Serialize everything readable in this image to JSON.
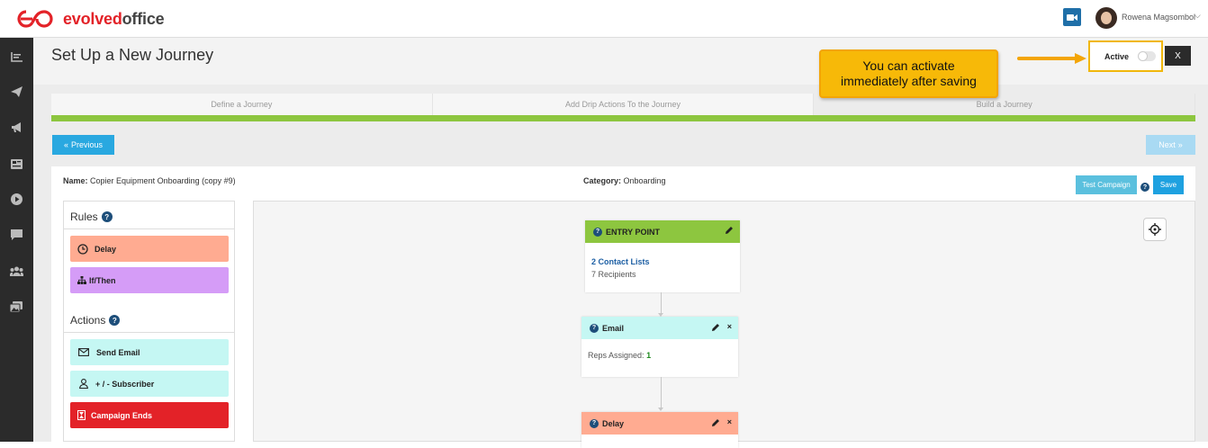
{
  "app": {
    "logo_brand_red": "evolved",
    "logo_brand_gray": "office",
    "user_name": "Rowena Magsombol",
    "colors": {
      "brand_red": "#e32228",
      "primary_blue": "#29a8e0",
      "sidebar": "#2b2b2b",
      "progress_green": "#8dc63f",
      "tooltip_yellow": "#f7b908"
    }
  },
  "header": {
    "title": "Set Up a New Journey",
    "active_label": "Active",
    "active_state": false,
    "close_label": "X"
  },
  "tooltip": {
    "line1": "You can activate",
    "line2": "immediately after saving"
  },
  "steps": [
    {
      "label": "Define a Journey"
    },
    {
      "label": "Add Drip Actions To the Journey"
    },
    {
      "label": "Build a Journey"
    }
  ],
  "nav": {
    "previous_label": "Previous",
    "next_label": "Next"
  },
  "campaign": {
    "name_label": "Name:",
    "name_value": "Copier Equipment Onboarding (copy #9)",
    "category_label": "Category:",
    "category_value": "Onboarding",
    "test_label": "Test Campaign",
    "save_label": "Save"
  },
  "rules": {
    "heading": "Rules",
    "items": [
      {
        "label": "Delay",
        "icon": "clock-icon",
        "color": "#ffab91"
      },
      {
        "label": "If/Then",
        "icon": "sitemap-icon",
        "color": "#d59cf7"
      }
    ]
  },
  "actions": {
    "heading": "Actions",
    "items": [
      {
        "label": "Send Email",
        "icon": "envelope-icon",
        "color": "#c5f7f3"
      },
      {
        "label": "+ / - Subscriber",
        "icon": "user-icon",
        "color": "#c5f7f3"
      },
      {
        "label": "Campaign Ends",
        "icon": "hourglass-icon",
        "color": "#e32228"
      }
    ]
  },
  "flow": {
    "entry": {
      "title": "ENTRY POINT",
      "lists": "2 Contact Lists",
      "recipients_count": "7",
      "recipients_label": "Recipients"
    },
    "email": {
      "title": "Email",
      "reps_label": "Reps Assigned:",
      "reps_value": "1"
    },
    "delay": {
      "title": "Delay"
    }
  }
}
